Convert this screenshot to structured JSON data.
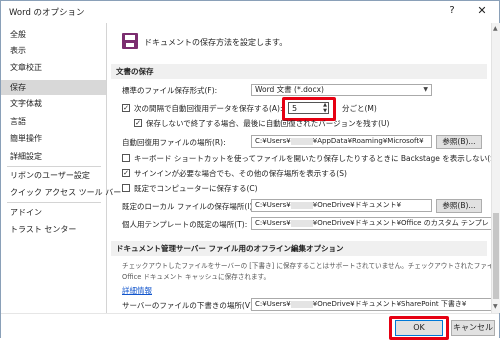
{
  "window": {
    "title": "Word のオプション",
    "help_glyph": "?",
    "close_glyph": "✕"
  },
  "sidebar": {
    "items": [
      {
        "label": "全般"
      },
      {
        "label": "表示"
      },
      {
        "label": "文章校正"
      },
      {
        "label": "保存"
      },
      {
        "label": "文字体裁"
      },
      {
        "label": "言語"
      },
      {
        "label": "簡単操作"
      },
      {
        "label": "詳細設定"
      },
      {
        "label": "リボンのユーザー設定"
      },
      {
        "label": "クイック アクセス ツール バー"
      },
      {
        "label": "アドイン"
      },
      {
        "label": "トラスト センター"
      }
    ],
    "selected": "保存"
  },
  "main": {
    "header": "ドキュメントの保存方法を設定します。",
    "save_section": {
      "title": "文書の保存",
      "format_label": "標準のファイル保存形式(F):",
      "format_value": "Word 文書 (*.docx)",
      "autorecover_label": "次の間隔で自動回復用データを保存する(A):",
      "autorecover_checked": "✓",
      "interval_value": "5",
      "interval_unit": "分ごと(M)",
      "keep_last_label": "保存しないで終了する場合、最後に自動回復されたバージョンを残す(U)",
      "keep_last_checked": "✓",
      "autorecover_path_label": "自動回復用ファイルの場所(R):",
      "autorecover_path_a": "C:¥Users¥",
      "autorecover_path_b": "¥AppData¥Roaming¥Microsoft¥",
      "browse_label": "参照(B)...",
      "backstage_label": "キーボード ショートカットを使ってファイルを開いたり保存したりするときに Backstage を表示しない(S)",
      "backstage_checked": "",
      "signin_label": "サインインが必要な場合でも、その他の保存場所を表示する(S)",
      "signin_checked": "✓",
      "default_pc_label": "既定でコンピューターに保存する(C)",
      "default_pc_checked": "",
      "local_path_label": "既定のローカル ファイルの保存場所(I):",
      "local_path_a": "C:¥Users¥",
      "local_path_b": "¥OneDrive¥ドキュメント¥",
      "local_browse_label": "参照(B)...",
      "template_path_label": "個人用テンプレートの既定の場所(T):",
      "template_path_a": "C:¥Users¥",
      "template_path_b": "¥OneDrive¥ドキュメント¥Office のカスタム テンプレ"
    },
    "offline_section": {
      "title": "ドキュメント管理サーバー ファイル用のオフライン編集オプション",
      "desc_line1": "チェックアウトしたファイルをサーバーの [下書き] に保存することはサポートされていません。チェックアウトされたファイルは",
      "desc_line2": "Office ドキュメント キャッシュに保存されます。",
      "link": "詳細情報",
      "drafts_label": "サーバーのファイルの下書きの場所(V):",
      "drafts_path_a": "C:¥Users¥",
      "drafts_path_b": "¥OneDrive¥ドキュメント¥SharePoint 下書き¥"
    }
  },
  "footer": {
    "ok_label": "OK",
    "cancel_label": "キャンセル"
  }
}
